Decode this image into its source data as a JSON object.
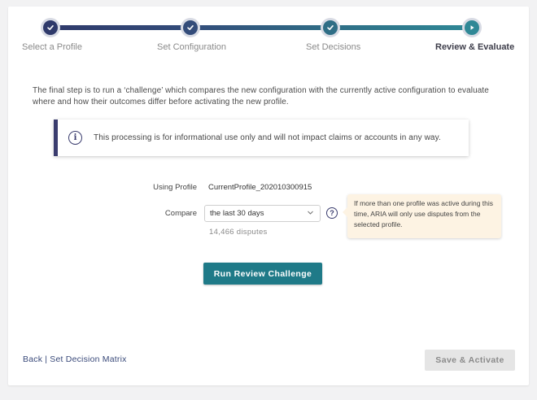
{
  "stepper": {
    "steps": [
      {
        "label": "Select a Profile",
        "state": "complete",
        "icon": "check-icon"
      },
      {
        "label": "Set Configuration",
        "state": "complete",
        "icon": "check-icon"
      },
      {
        "label": "Set Decisions",
        "state": "complete",
        "icon": "check-icon"
      },
      {
        "label": "Review & Evaluate",
        "state": "current",
        "icon": "play-icon"
      }
    ]
  },
  "intro_text": "The final step is to run a ‘challenge’ which compares the new configuration with the currently active configuration to evaluate where and how their outcomes differ before activating the new profile.",
  "notice": {
    "icon": "info-icon",
    "icon_glyph": "i",
    "text": "This processing is for informational use only and will not impact claims or accounts in any way."
  },
  "profile": {
    "label": "Using Profile",
    "value": "CurrentProfile_202010300915"
  },
  "compare": {
    "label": "Compare",
    "selected": "the last 30 days",
    "help_glyph": "?",
    "tooltip": "If more than one profile was active during this time, ARIA will only use disputes from the selected profile.",
    "count_text": "14,466 disputes"
  },
  "actions": {
    "run_label": "Run Review Challenge",
    "back_label": "Back | Set Decision Matrix",
    "save_label": "Save & Activate"
  },
  "colors": {
    "navy": "#2f3a6b",
    "teal": "#1f7a88",
    "tooltip_bg": "#fdf3e3",
    "disabled_bg": "#e5e5e5"
  }
}
